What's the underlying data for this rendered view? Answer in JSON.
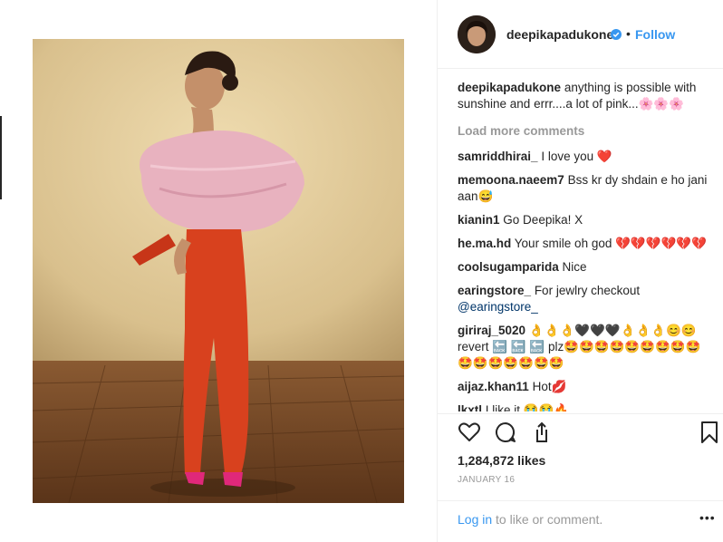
{
  "post": {
    "username": "deepikapadukone",
    "follow_label": "Follow",
    "dot": "•",
    "caption": "anything is possible with sunshine and errr....a lot of pink...🌸🌸🌸",
    "load_more": "Load more comments",
    "likes": "1,284,872 likes",
    "date": "JANUARY 16",
    "login_link": "Log in",
    "login_rest": " to like or comment.",
    "more": "•••"
  },
  "comments": [
    {
      "user": "samriddhirai_",
      "text": "I love you ❤️"
    },
    {
      "user": "memoona.naeem7",
      "text": "Bss kr dy shdain e ho jani aan😅"
    },
    {
      "user": "kianin1",
      "text": "Go Deepika! X"
    },
    {
      "user": "he.ma.hd",
      "text": "Your smile oh god 💔💔💔💔💔💔"
    },
    {
      "user": "coolsugamparida",
      "text": "Nice"
    },
    {
      "user": "earingstore_",
      "text": "For jewlry checkout",
      "link": "@earingstore_"
    },
    {
      "user": "giriraj_5020",
      "text": "👌👌👌🖤🖤🖤👌👌👌😊😊 revert 🔙 🔙 🔙 plz🤩🤩🤩🤩🤩🤩🤩🤩🤩🤩🤩🤩🤩🤩🤩🤩"
    },
    {
      "user": "aijaz.khan11",
      "text": "Hot💋"
    },
    {
      "user": "lkxtl",
      "text": "I like it 😭😭🔥"
    }
  ],
  "icons": {
    "heart": "heart-icon",
    "comment": "comment-icon",
    "share": "share-icon",
    "save": "bookmark-icon",
    "verified": "verified-badge-icon"
  },
  "colors": {
    "accent": "#3897f0",
    "text": "#262626",
    "muted": "#999999",
    "border": "#efefef"
  }
}
